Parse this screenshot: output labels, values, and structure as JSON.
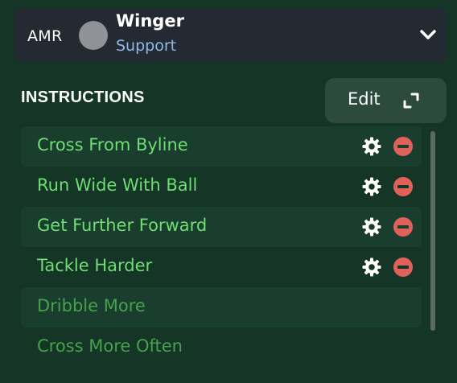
{
  "role": {
    "position": "AMR",
    "name": "Winger",
    "duty": "Support"
  },
  "instructions": {
    "title": "INSTRUCTIONS",
    "edit_label": "Edit",
    "items": [
      {
        "label": "Cross From Byline",
        "active": true
      },
      {
        "label": "Run Wide With Ball",
        "active": true
      },
      {
        "label": "Get Further Forward",
        "active": true
      },
      {
        "label": "Tackle Harder",
        "active": true
      },
      {
        "label": "Dribble More",
        "active": false
      },
      {
        "label": "Cross More Often",
        "active": false
      }
    ]
  },
  "colors": {
    "background": "#153527",
    "active_text": "#6ede72",
    "inactive_text": "#47a04b",
    "remove": "#e0605a",
    "duty_text": "#8fb7ec"
  },
  "icons": [
    "chevron-down-icon",
    "expand-icon",
    "gear-icon",
    "remove-icon"
  ]
}
